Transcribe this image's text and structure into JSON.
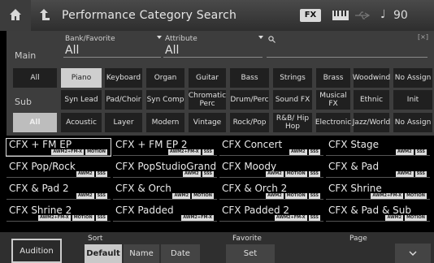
{
  "topbar": {
    "title": "Performance Category Search",
    "fx_label": "FX",
    "note_glyph": "♩",
    "tempo": "90"
  },
  "filters": {
    "main_label": "Main",
    "sub_label": "Sub",
    "bank_label": "Bank/Favorite",
    "bank_value": "All",
    "attr_label": "Attribute",
    "attr_value": "All",
    "search_placeholder": ""
  },
  "main_categories": [
    "All",
    "Piano",
    "Keyboard",
    "Organ",
    "Guitar",
    "Bass",
    "Strings",
    "Brass",
    "Woodwind",
    "No Assign"
  ],
  "main_extra": [
    "Syn Lead",
    "Pad/Choir",
    "Syn Comp",
    "Chromatic Perc",
    "Drum/Perc",
    "Sound FX",
    "Musical FX",
    "Ethnic",
    "Init"
  ],
  "sub_categories": [
    "All",
    "Acoustic",
    "Layer",
    "Modern",
    "Vintage",
    "Rock/Pop",
    "R&B/ Hip Hop",
    "Electronic",
    "Jazz/World",
    "No Assign"
  ],
  "results": [
    {
      "name": "CFX + FM EP",
      "badges": [
        "AWM2+FM-X",
        "MOTION"
      ]
    },
    {
      "name": "CFX + FM EP 2",
      "badges": [
        "AWM2+FM-X",
        "SSS"
      ]
    },
    {
      "name": "CFX Concert",
      "badges": [
        "AWM2",
        "SSS"
      ]
    },
    {
      "name": "CFX Stage",
      "badges": [
        "AWM2",
        "SSS"
      ]
    },
    {
      "name": "CFX Pop/Rock",
      "badges": [
        "AWM2",
        "SSS"
      ]
    },
    {
      "name": "CFX PopStudioGrand",
      "badges": [
        "AWM2",
        "SSS"
      ]
    },
    {
      "name": "CFX Moody",
      "badges": [
        "AWM2",
        "MOTION",
        "SSS"
      ]
    },
    {
      "name": "CFX & Pad",
      "badges": [
        "AWM2",
        "SSS"
      ]
    },
    {
      "name": "CFX & Pad 2",
      "badges": [
        "AWM2",
        "SSS"
      ]
    },
    {
      "name": "CFX & Orch",
      "badges": [
        "AWM2",
        "MOTION"
      ]
    },
    {
      "name": "CFX & Orch 2",
      "badges": [
        "AWM2",
        "MOTION",
        "SSS"
      ]
    },
    {
      "name": "CFX Shrine",
      "badges": [
        "AWM2+FM-X",
        "MOTION"
      ]
    },
    {
      "name": "CFX Shrine 2",
      "badges": [
        "AWM2+FM-X",
        "MOTION",
        "SSS"
      ]
    },
    {
      "name": "CFX Padded",
      "badges": [
        "AWM2+FM-X"
      ]
    },
    {
      "name": "CFX Padded 2",
      "badges": [
        "AWM2+FM-X",
        "SSS"
      ]
    },
    {
      "name": "CFX & Pad & Sub",
      "badges": [
        "AWM2",
        "MOTION"
      ]
    }
  ],
  "bottom": {
    "audition": "Audition",
    "sort_label": "Sort",
    "sort_default": "Default",
    "sort_name": "Name",
    "sort_date": "Date",
    "favorite_label": "Favorite",
    "favorite_set": "Set",
    "page_label": "Page"
  }
}
